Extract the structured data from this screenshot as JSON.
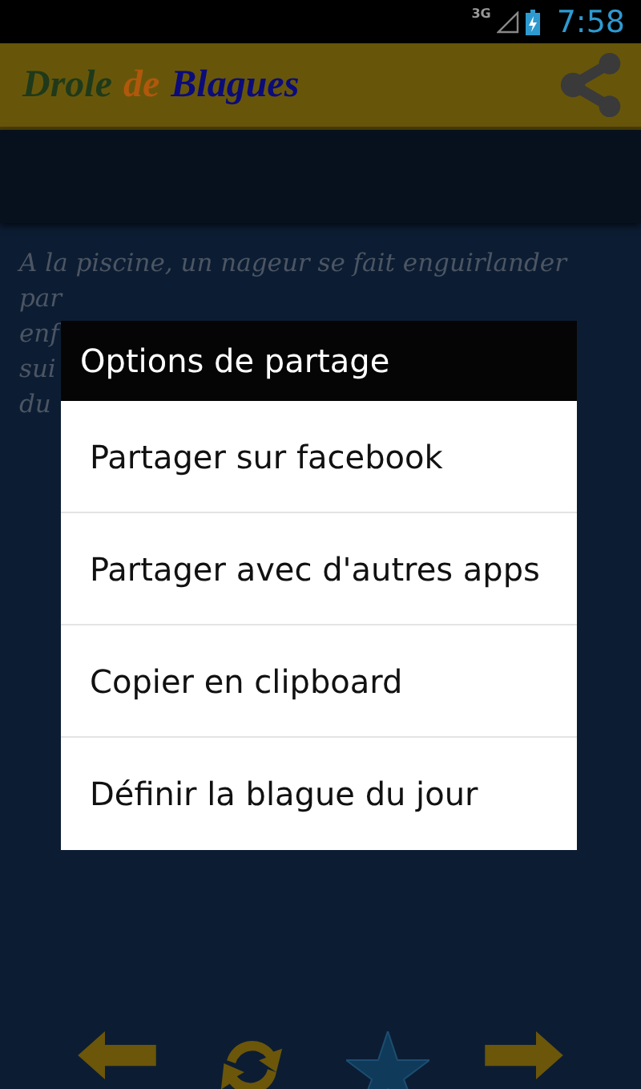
{
  "status_bar": {
    "network": "3G",
    "time": "7:58"
  },
  "app_bar": {
    "title_words": [
      {
        "text": "Drole",
        "color": "#1f3a1a"
      },
      {
        "text": "de",
        "color": "#b0580c"
      },
      {
        "text": "Blagues",
        "color": "#0b0b7a"
      }
    ]
  },
  "joke": {
    "first_line": "A la piscine, un nageur se fait enguirlander",
    "line_starts": [
      "par",
      "enf",
      "sui",
      "du"
    ]
  },
  "dialog": {
    "title": "Options de partage",
    "items": [
      "Partager sur facebook",
      "Partager avec d'autres apps",
      "Copier en clipboard",
      "Définir la blague du jour"
    ]
  }
}
